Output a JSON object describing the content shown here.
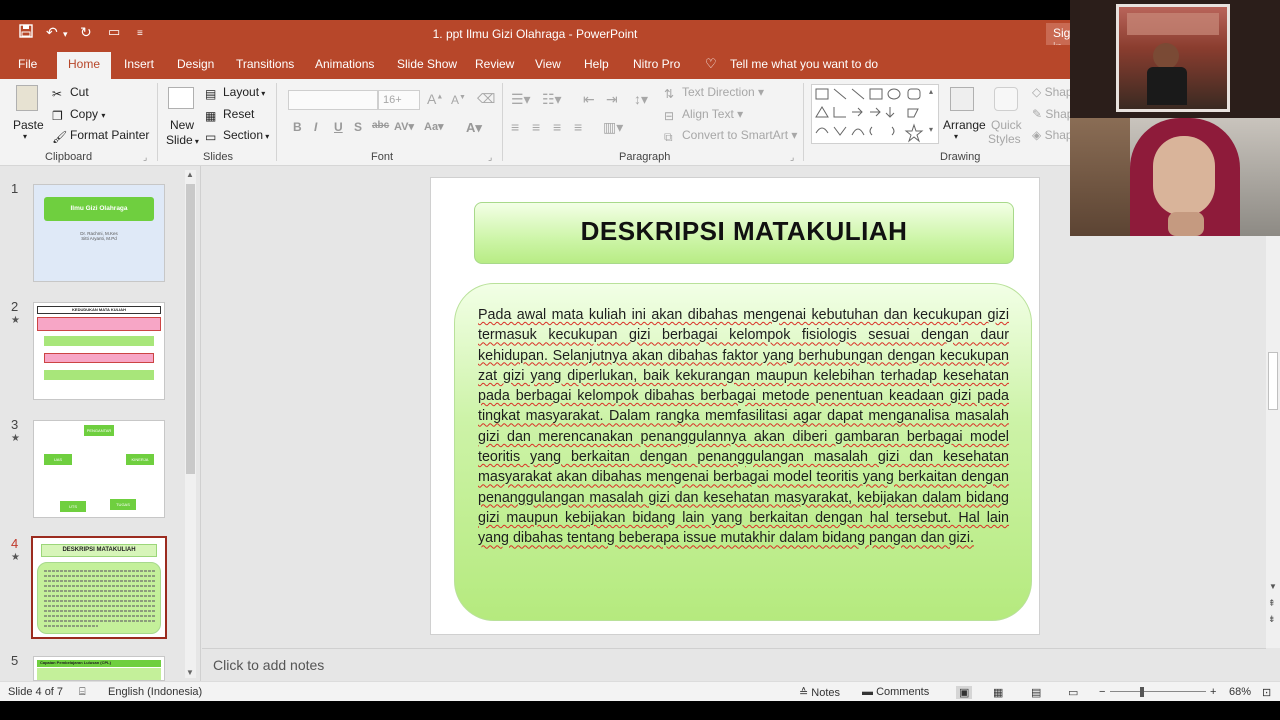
{
  "window": {
    "title": "1. ppt Ilmu Gizi Olahraga  -  PowerPoint",
    "sign_in": "Sign in"
  },
  "tabs": [
    "File",
    "Home",
    "Insert",
    "Design",
    "Transitions",
    "Animations",
    "Slide Show",
    "Review",
    "View",
    "Help",
    "Nitro Pro"
  ],
  "tell_me": "Tell me what you want to do",
  "ribbon": {
    "clipboard": {
      "paste": "Paste",
      "cut": "Cut",
      "copy": "Copy",
      "format_painter": "Format Painter",
      "label": "Clipboard"
    },
    "slides": {
      "new_slide": "New",
      "new_slide2": "Slide",
      "layout": "Layout",
      "reset": "Reset",
      "section": "Section",
      "label": "Slides"
    },
    "font": {
      "size": "16+",
      "label": "Font"
    },
    "paragraph": {
      "text_direction": "Text Direction",
      "align_text": "Align Text",
      "convert": "Convert to SmartArt",
      "label": "Paragraph"
    },
    "drawing": {
      "arrange": "Arrange",
      "quick_styles": "Quick",
      "quick_styles2": "Styles",
      "shape": "Shap",
      "label": "Drawing"
    }
  },
  "thumbnails": [
    {
      "num": "1",
      "title": "Ilmu Gizi Olahraga",
      "line1": "Dr. Rachmi, M.Kes",
      "line2": "Sitti Aryanti, M.Pd"
    },
    {
      "num": "2",
      "star": "★",
      "title": "KEDUDUKAN MATA KULIAH"
    },
    {
      "num": "3",
      "star": "★",
      "top": "PENGANTAR",
      "left": "UAS",
      "right": "KINERJA",
      "bl": "UTS",
      "br": "TUGAS"
    },
    {
      "num": "4",
      "star": "★",
      "title": "DESKRIPSI MATAKULIAH"
    },
    {
      "num": "5",
      "title": "Capaian Pembelajaran Lulusan (CPL)"
    }
  ],
  "slide": {
    "title": "DESKRIPSI MATAKULIAH",
    "body": "Pada awal mata kuliah ini akan dibahas mengenai kebutuhan dan kecukupan gizi termasuk kecukupan gizi berbagai kelompok fisiologis sesuai dengan daur kehidupan. Selanjutnya akan dibahas faktor yang berhubungan dengan kecukupan zat gizi yang diperlukan, baik kekurangan maupun kelebihan terhadap kesehatan pada berbagai kelompok dibahas berbagai metode penentuan keadaan gizi pada tingkat masyarakat. Dalam rangka memfasilitasi agar dapat menganalisa masalah gizi dan merencanakan penanggulannya akan diberi gambaran berbagai model teoritis yang berkaitan dengan penanggulangan masalah gizi dan kesehatan masyarakat akan dibahas mengenai berbagai model teoritis yang berkaitan dengan penanggulangan masalah gizi dan kesehatan masyarakat, kebijakan dalam bidang gizi maupun kebijakan bidang lain yang berkaitan dengan hal tersebut. Hal lain yang dibahas tentang beberapa issue mutakhir dalam bidang pangan dan gizi."
  },
  "notes_placeholder": "Click to add notes",
  "status": {
    "slide": "Slide 4 of 7",
    "language": "English (Indonesia)",
    "notes": "Notes",
    "comments": "Comments",
    "zoom": "68%"
  },
  "colors": {
    "accent": "#b7472a",
    "slide_green": "#c4f09a"
  }
}
